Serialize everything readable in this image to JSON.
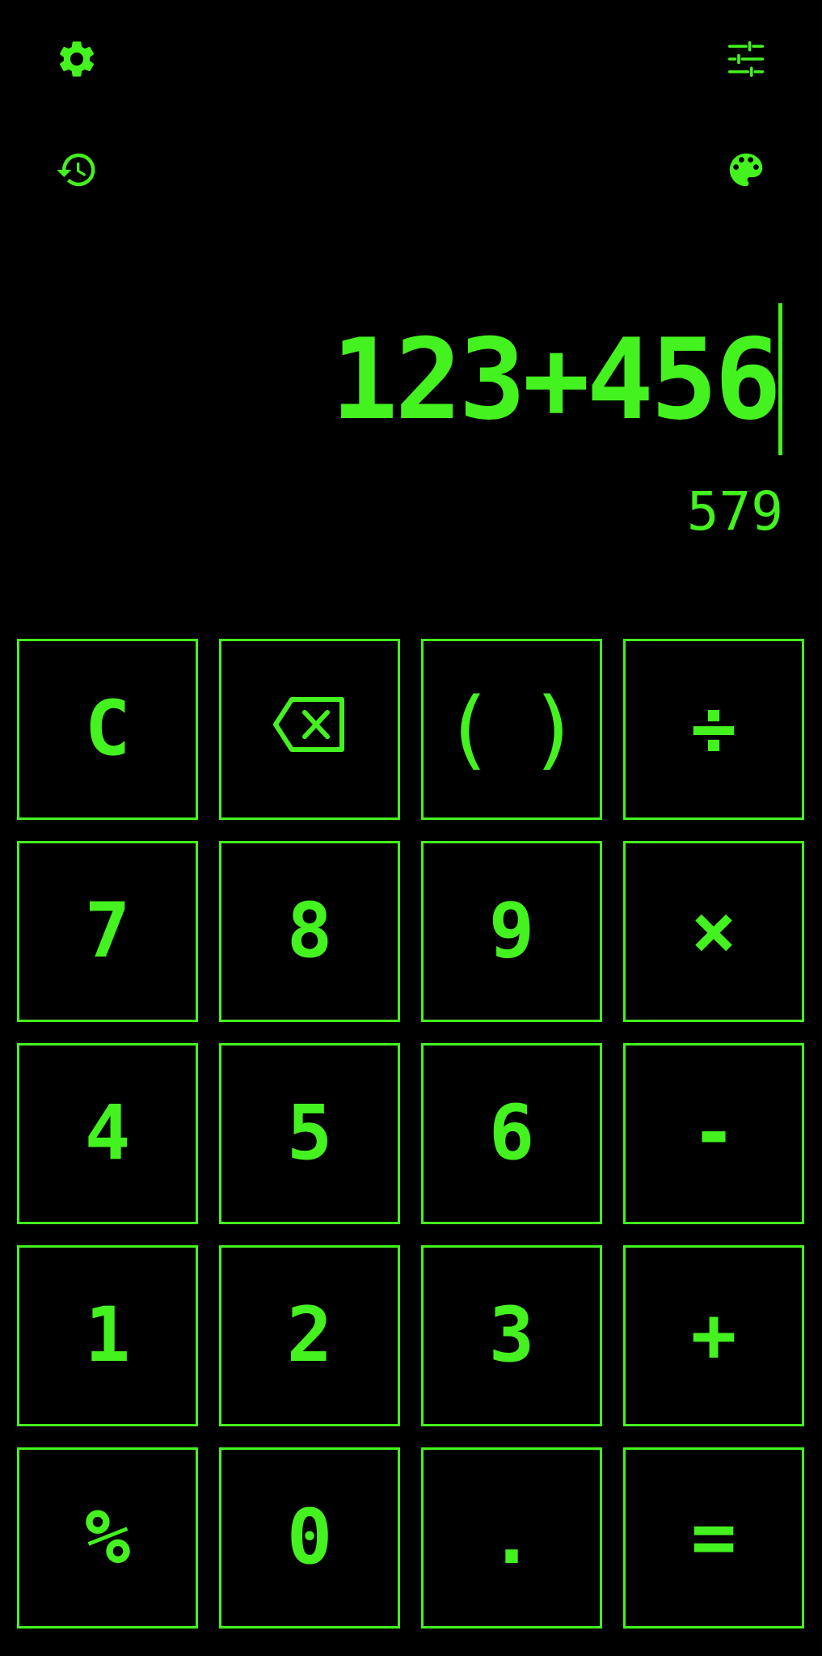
{
  "colors": {
    "background": "#000000",
    "accent": "#44f21f"
  },
  "toolbar": {
    "settings_icon": "settings-gear-icon",
    "history_icon": "history-icon",
    "tune_icon": "tune-sliders-icon",
    "theme_icon": "palette-icon"
  },
  "display": {
    "expression": "123+456",
    "result": "579"
  },
  "keypad": {
    "keys": [
      {
        "label": "C",
        "name": "clear-button"
      },
      {
        "label": "",
        "name": "backspace-button",
        "icon": "backspace-icon"
      },
      {
        "label": "()",
        "name": "parentheses-button"
      },
      {
        "label": "÷",
        "name": "divide-button"
      },
      {
        "label": "7",
        "name": "digit-7-button"
      },
      {
        "label": "8",
        "name": "digit-8-button"
      },
      {
        "label": "9",
        "name": "digit-9-button"
      },
      {
        "label": "×",
        "name": "multiply-button"
      },
      {
        "label": "4",
        "name": "digit-4-button"
      },
      {
        "label": "5",
        "name": "digit-5-button"
      },
      {
        "label": "6",
        "name": "digit-6-button"
      },
      {
        "label": "-",
        "name": "subtract-button"
      },
      {
        "label": "1",
        "name": "digit-1-button"
      },
      {
        "label": "2",
        "name": "digit-2-button"
      },
      {
        "label": "3",
        "name": "digit-3-button"
      },
      {
        "label": "+",
        "name": "add-button"
      },
      {
        "label": "%",
        "name": "percent-button"
      },
      {
        "label": "0",
        "name": "digit-0-button"
      },
      {
        "label": ".",
        "name": "decimal-button"
      },
      {
        "label": "=",
        "name": "equals-button"
      }
    ]
  }
}
